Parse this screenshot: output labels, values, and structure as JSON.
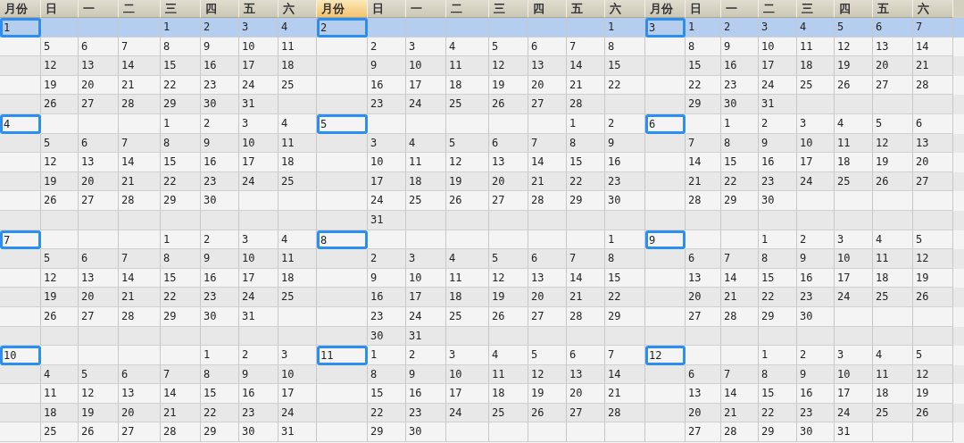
{
  "columns": [
    {
      "label": "月份",
      "active": false
    },
    {
      "label": "日",
      "active": false
    },
    {
      "label": "一",
      "active": false
    },
    {
      "label": "二",
      "active": false
    },
    {
      "label": "三",
      "active": false
    },
    {
      "label": "四",
      "active": false
    },
    {
      "label": "五",
      "active": false
    },
    {
      "label": "六",
      "active": false
    },
    {
      "label": "月份",
      "active": true
    },
    {
      "label": "日",
      "active": false
    },
    {
      "label": "一",
      "active": false
    },
    {
      "label": "二",
      "active": false
    },
    {
      "label": "三",
      "active": false
    },
    {
      "label": "四",
      "active": false
    },
    {
      "label": "五",
      "active": false
    },
    {
      "label": "六",
      "active": false
    },
    {
      "label": "月份",
      "active": false
    },
    {
      "label": "日",
      "active": false
    },
    {
      "label": "一",
      "active": false
    },
    {
      "label": "二",
      "active": false
    },
    {
      "label": "三",
      "active": false
    },
    {
      "label": "四",
      "active": false
    },
    {
      "label": "五",
      "active": false
    },
    {
      "label": "六",
      "active": false
    }
  ],
  "rows": [
    {
      "selected": true,
      "cells": [
        "1",
        null,
        null,
        null,
        "1",
        "2",
        "3",
        "4",
        "2",
        null,
        null,
        null,
        null,
        null,
        null,
        "1",
        "3",
        "1",
        "2",
        "3",
        "4",
        "5",
        "6",
        "7"
      ]
    },
    {
      "selected": false,
      "cells": [
        null,
        "5",
        "6",
        "7",
        "8",
        "9",
        "10",
        "11",
        null,
        "2",
        "3",
        "4",
        "5",
        "6",
        "7",
        "8",
        null,
        "8",
        "9",
        "10",
        "11",
        "12",
        "13",
        "14"
      ]
    },
    {
      "selected": false,
      "cells": [
        null,
        "12",
        "13",
        "14",
        "15",
        "16",
        "17",
        "18",
        null,
        "9",
        "10",
        "11",
        "12",
        "13",
        "14",
        "15",
        null,
        "15",
        "16",
        "17",
        "18",
        "19",
        "20",
        "21"
      ]
    },
    {
      "selected": false,
      "cells": [
        null,
        "19",
        "20",
        "21",
        "22",
        "23",
        "24",
        "25",
        null,
        "16",
        "17",
        "18",
        "19",
        "20",
        "21",
        "22",
        null,
        "22",
        "23",
        "24",
        "25",
        "26",
        "27",
        "28"
      ]
    },
    {
      "selected": false,
      "cells": [
        null,
        "26",
        "27",
        "28",
        "29",
        "30",
        "31",
        null,
        null,
        "23",
        "24",
        "25",
        "26",
        "27",
        "28",
        null,
        null,
        "29",
        "30",
        "31",
        null,
        null,
        null,
        null
      ]
    },
    {
      "selected": false,
      "cells": [
        "4",
        null,
        null,
        null,
        "1",
        "2",
        "3",
        "4",
        "5",
        null,
        null,
        null,
        null,
        null,
        "1",
        "2",
        "6",
        null,
        "1",
        "2",
        "3",
        "4",
        "5",
        "6"
      ]
    },
    {
      "selected": false,
      "cells": [
        null,
        "5",
        "6",
        "7",
        "8",
        "9",
        "10",
        "11",
        null,
        "3",
        "4",
        "5",
        "6",
        "7",
        "8",
        "9",
        null,
        "7",
        "8",
        "9",
        "10",
        "11",
        "12",
        "13"
      ]
    },
    {
      "selected": false,
      "cells": [
        null,
        "12",
        "13",
        "14",
        "15",
        "16",
        "17",
        "18",
        null,
        "10",
        "11",
        "12",
        "13",
        "14",
        "15",
        "16",
        null,
        "14",
        "15",
        "16",
        "17",
        "18",
        "19",
        "20"
      ]
    },
    {
      "selected": false,
      "cells": [
        null,
        "19",
        "20",
        "21",
        "22",
        "23",
        "24",
        "25",
        null,
        "17",
        "18",
        "19",
        "20",
        "21",
        "22",
        "23",
        null,
        "21",
        "22",
        "23",
        "24",
        "25",
        "26",
        "27"
      ]
    },
    {
      "selected": false,
      "cells": [
        null,
        "26",
        "27",
        "28",
        "29",
        "30",
        null,
        null,
        null,
        "24",
        "25",
        "26",
        "27",
        "28",
        "29",
        "30",
        null,
        "28",
        "29",
        "30",
        null,
        null,
        null,
        null
      ]
    },
    {
      "selected": false,
      "cells": [
        null,
        null,
        null,
        null,
        null,
        null,
        null,
        null,
        null,
        "31",
        null,
        null,
        null,
        null,
        null,
        null,
        null,
        null,
        null,
        null,
        null,
        null,
        null,
        null
      ]
    },
    {
      "selected": false,
      "cells": [
        "7",
        null,
        null,
        null,
        "1",
        "2",
        "3",
        "4",
        "8",
        null,
        null,
        null,
        null,
        null,
        null,
        "1",
        "9",
        null,
        null,
        "1",
        "2",
        "3",
        "4",
        "5"
      ]
    },
    {
      "selected": false,
      "cells": [
        null,
        "5",
        "6",
        "7",
        "8",
        "9",
        "10",
        "11",
        null,
        "2",
        "3",
        "4",
        "5",
        "6",
        "7",
        "8",
        null,
        "6",
        "7",
        "8",
        "9",
        "10",
        "11",
        "12"
      ]
    },
    {
      "selected": false,
      "cells": [
        null,
        "12",
        "13",
        "14",
        "15",
        "16",
        "17",
        "18",
        null,
        "9",
        "10",
        "11",
        "12",
        "13",
        "14",
        "15",
        null,
        "13",
        "14",
        "15",
        "16",
        "17",
        "18",
        "19"
      ]
    },
    {
      "selected": false,
      "cells": [
        null,
        "19",
        "20",
        "21",
        "22",
        "23",
        "24",
        "25",
        null,
        "16",
        "17",
        "18",
        "19",
        "20",
        "21",
        "22",
        null,
        "20",
        "21",
        "22",
        "23",
        "24",
        "25",
        "26"
      ]
    },
    {
      "selected": false,
      "cells": [
        null,
        "26",
        "27",
        "28",
        "29",
        "30",
        "31",
        null,
        null,
        "23",
        "24",
        "25",
        "26",
        "27",
        "28",
        "29",
        null,
        "27",
        "28",
        "29",
        "30",
        null,
        null,
        null
      ]
    },
    {
      "selected": false,
      "cells": [
        null,
        null,
        null,
        null,
        null,
        null,
        null,
        null,
        null,
        "30",
        "31",
        null,
        null,
        null,
        null,
        null,
        null,
        null,
        null,
        null,
        null,
        null,
        null,
        null
      ]
    },
    {
      "selected": false,
      "cells": [
        "10",
        null,
        null,
        null,
        null,
        "1",
        "2",
        "3",
        "11",
        "1",
        "2",
        "3",
        "4",
        "5",
        "6",
        "7",
        "12",
        null,
        null,
        "1",
        "2",
        "3",
        "4",
        "5"
      ]
    },
    {
      "selected": false,
      "cells": [
        null,
        "4",
        "5",
        "6",
        "7",
        "8",
        "9",
        "10",
        null,
        "8",
        "9",
        "10",
        "11",
        "12",
        "13",
        "14",
        null,
        "6",
        "7",
        "8",
        "9",
        "10",
        "11",
        "12"
      ]
    },
    {
      "selected": false,
      "cells": [
        null,
        "11",
        "12",
        "13",
        "14",
        "15",
        "16",
        "17",
        null,
        "15",
        "16",
        "17",
        "18",
        "19",
        "20",
        "21",
        null,
        "13",
        "14",
        "15",
        "16",
        "17",
        "18",
        "19"
      ]
    },
    {
      "selected": false,
      "cells": [
        null,
        "18",
        "19",
        "20",
        "21",
        "22",
        "23",
        "24",
        null,
        "22",
        "23",
        "24",
        "25",
        "26",
        "27",
        "28",
        null,
        "20",
        "21",
        "22",
        "23",
        "24",
        "25",
        "26"
      ]
    },
    {
      "selected": false,
      "cells": [
        null,
        "25",
        "26",
        "27",
        "28",
        "29",
        "30",
        "31",
        null,
        "29",
        "30",
        null,
        null,
        null,
        null,
        null,
        null,
        "27",
        "28",
        "29",
        "30",
        "31",
        null,
        null
      ]
    }
  ]
}
